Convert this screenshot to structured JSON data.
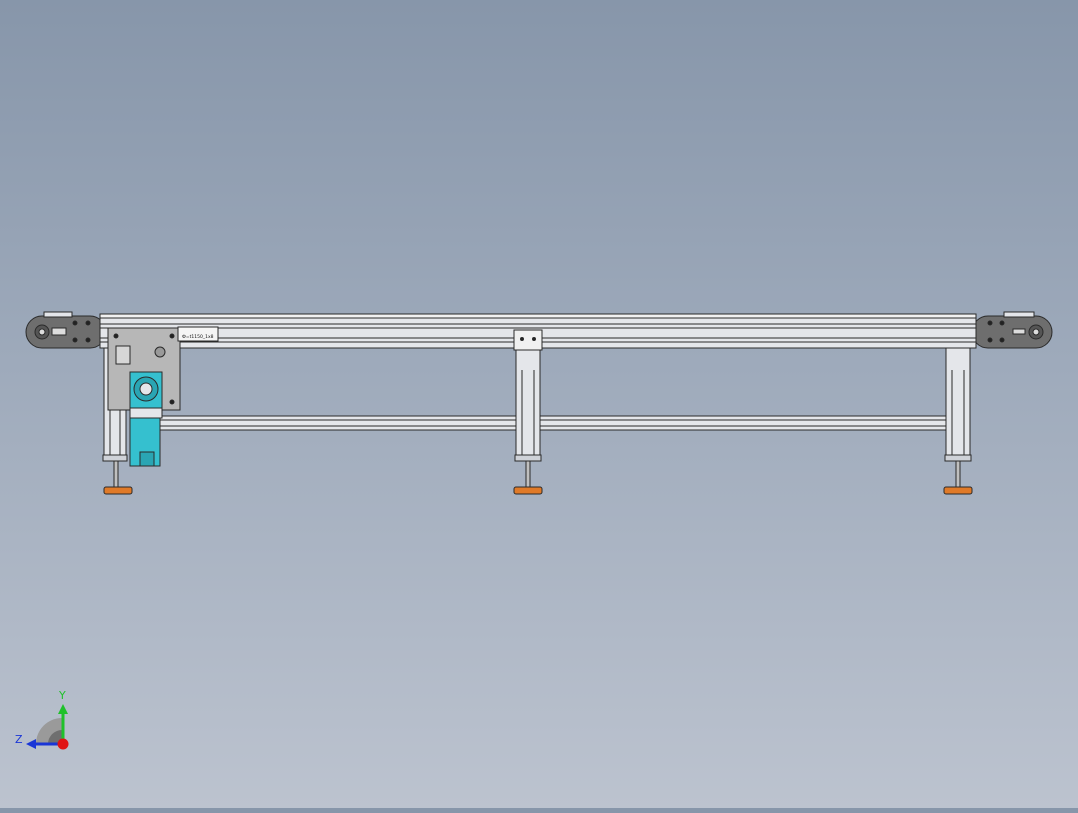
{
  "scene": {
    "background_top": "#8796aa",
    "background_bottom": "#bcc3cf"
  },
  "conveyor": {
    "frame_color": "#e4e6ea",
    "outline_color": "#2a2a2a",
    "end_cap_color": "#6e6e6e",
    "motor_color": "#35c0cf",
    "foot_pad_color": "#e07a28",
    "nameplate_text": "Ф=t1150_1x8",
    "leg_count": 3
  },
  "triad": {
    "y_label": "Y",
    "z_label": "Z",
    "y_color": "#1fc12a",
    "z_color": "#1a36d6",
    "origin_color": "#e01414"
  }
}
